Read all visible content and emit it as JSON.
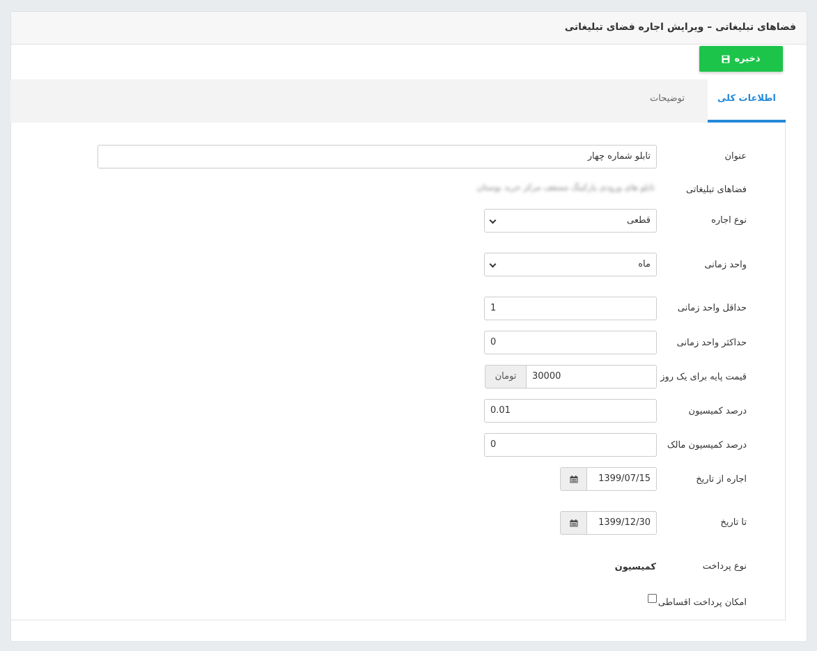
{
  "header": {
    "title": "فضاهای تبلیغاتی – ویرایش اجاره فضای تبلیغاتی"
  },
  "toolbar": {
    "save_label": "ذخیره",
    "save_icon": "floppy-disk-icon",
    "accent_color": "#1cc44a"
  },
  "tabs": [
    {
      "label": "اطلاعات کلی",
      "active": true
    },
    {
      "label": "توضیحات",
      "active": false
    }
  ],
  "form": {
    "title_label": "عنوان",
    "title_value": "تابلو شماره چهار",
    "ad_spaces_label": "فضاهای تبلیغاتی",
    "ad_spaces_value": "تابلو های ورودی پارکینگ مسقف مرکز خرید بوستان",
    "rent_type_label": "نوع اجاره",
    "rent_type_value": "قطعی",
    "time_unit_label": "واحد زمانی",
    "time_unit_value": "ماه",
    "min_unit_label": "حداقل واحد زمانی",
    "min_unit_value": "1",
    "max_unit_label": "حداکثر واحد زمانی",
    "max_unit_value": "0",
    "base_price_label": "قیمت پایه برای یک روز",
    "base_price_value": "30000",
    "currency": "تومان",
    "commission_label": "درصد کمیسیون",
    "commission_value": "0.01",
    "owner_commission_label": "درصد کمیسیون مالک",
    "owner_commission_value": "0",
    "from_date_label": "اجاره از تاریخ",
    "from_date_value": "1399/07/15",
    "to_date_label": "تا تاریخ",
    "to_date_value": "1399/12/30",
    "payment_type_label": "نوع پرداخت",
    "payment_type_value": "کمیسیون",
    "installment_label": "امکان پرداخت اقساطی",
    "installment_checked": false
  }
}
